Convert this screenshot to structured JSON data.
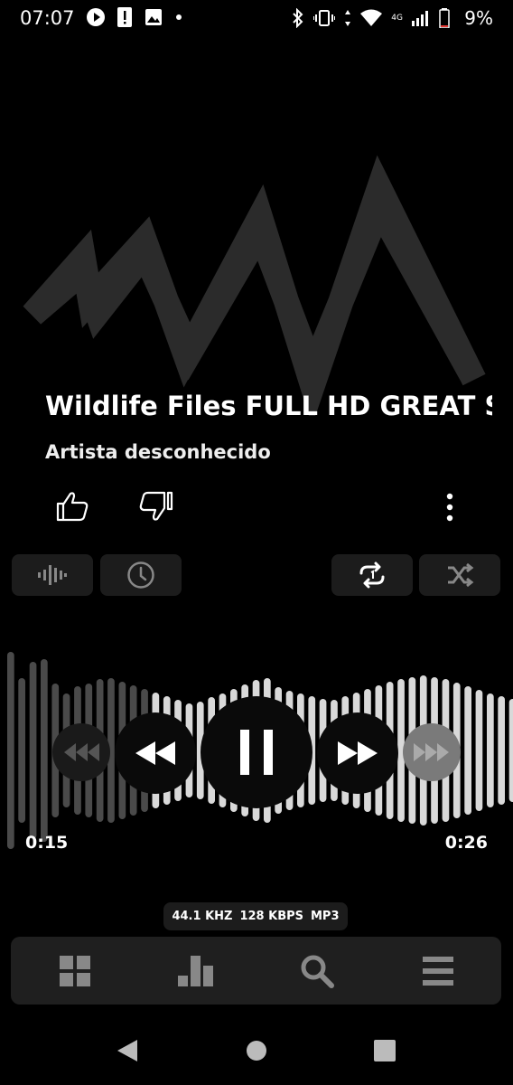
{
  "status_bar": {
    "time": "07:07",
    "battery_percent": "9%",
    "network_label": "4G"
  },
  "track": {
    "title": "Wildlife Files FULL HD GREAT SP",
    "artist": "Artista desconhecido"
  },
  "playback": {
    "current_time": "0:15",
    "total_time": "0:26",
    "progress": 0.577
  },
  "format": {
    "sample_rate": "44.1 KHZ",
    "bitrate": "128 KBPS",
    "codec": "MP3"
  },
  "icons": {
    "like": "thumb-up-icon",
    "dislike": "thumb-down-icon",
    "more": "more-vertical-icon",
    "equalizer": "equalizer-icon",
    "sleep_timer": "clock-icon",
    "repeat": "repeat-one-icon",
    "shuffle": "shuffle-icon",
    "nav": [
      "grid-icon",
      "chart-icon",
      "search-icon",
      "menu-icon"
    ]
  },
  "colors": {
    "background": "#000000",
    "chip_bg": "#1c1c1c",
    "waveform_played": "#4a4a4a",
    "waveform_unplayed": "#d9d9d9"
  }
}
